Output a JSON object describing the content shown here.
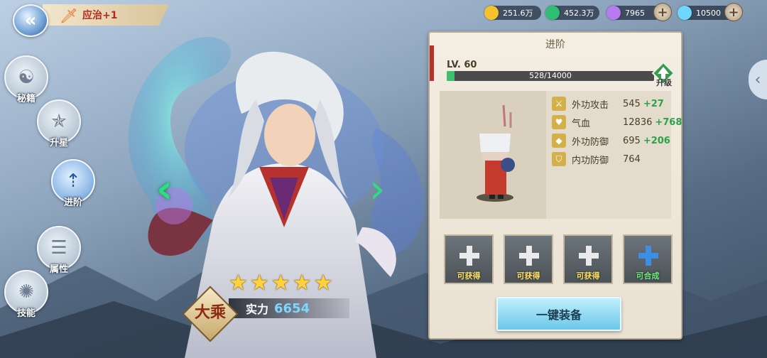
{
  "header": {
    "back_icon": "back-arrow-icon",
    "title": "应治+1",
    "title_icon": "sword-icon"
  },
  "resources": [
    {
      "name": "gold",
      "icon": "gold-coin-icon",
      "value": "251.6万",
      "color": "#f5c22b"
    },
    {
      "name": "jade",
      "icon": "green-gem-icon",
      "value": "452.3万",
      "color": "#2fbf74"
    },
    {
      "name": "crystal",
      "icon": "purple-crystal-icon",
      "value": "7965",
      "color": "#b77bf0"
    },
    {
      "name": "diamond",
      "icon": "diamond-icon",
      "value": "10500",
      "color": "#6fd7ff"
    }
  ],
  "left_menu": [
    {
      "label": "秘籍",
      "icon": "yin-yang-icon"
    },
    {
      "label": "升星",
      "icon": "stars-icon"
    },
    {
      "label": "进阶",
      "icon": "advance-arrow-icon",
      "active": true
    },
    {
      "label": "属性",
      "icon": "list-icon"
    },
    {
      "label": "技能",
      "icon": "skill-icon"
    }
  ],
  "hero": {
    "stars": 5,
    "rank": "大乘",
    "power_label": "实力",
    "power_value": "6654"
  },
  "panel": {
    "title": "进阶",
    "level": "LV. 60",
    "xp_text": "528/14000",
    "xp_fraction": 0.0377,
    "upgrade_label": "升级",
    "stats": [
      {
        "name": "外功攻击",
        "value": "545",
        "bonus": "+27",
        "icon": "sword-icon"
      },
      {
        "name": "气血",
        "value": "12836",
        "bonus": "+768",
        "icon": "heart-icon"
      },
      {
        "name": "外功防御",
        "value": "695",
        "bonus": "+206",
        "icon": "armor-icon"
      },
      {
        "name": "内功防御",
        "value": "764",
        "bonus": "",
        "icon": "shield-icon"
      }
    ],
    "slots": [
      {
        "label": "可获得",
        "icon": "sword-plus-icon",
        "type": "obtain"
      },
      {
        "label": "可获得",
        "icon": "helmet-plus-icon",
        "type": "obtain"
      },
      {
        "label": "可获得",
        "icon": "feather-plus-icon",
        "type": "obtain"
      },
      {
        "label": "可合成",
        "icon": "compose-plus-icon",
        "type": "craft"
      }
    ],
    "equip_button": "一键装备"
  }
}
